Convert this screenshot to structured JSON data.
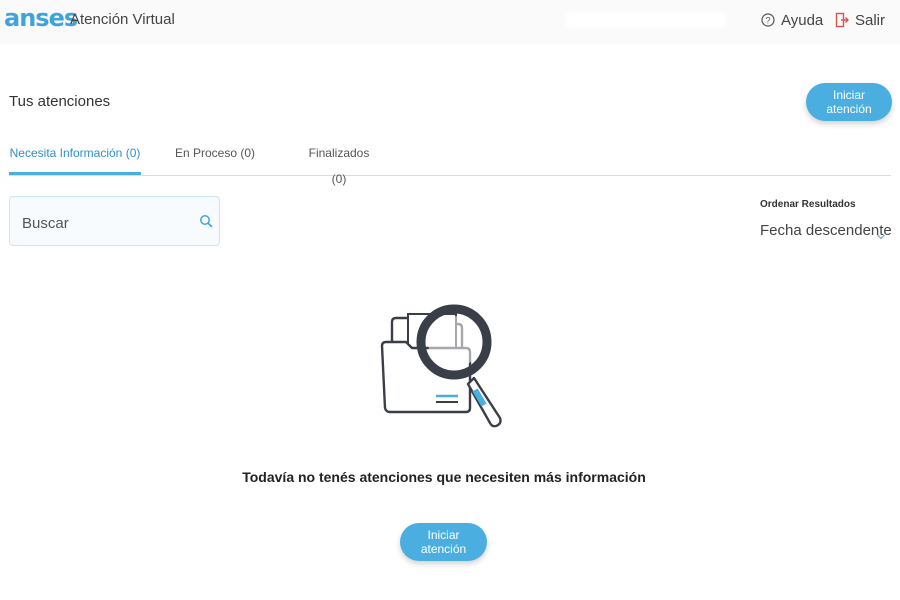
{
  "header": {
    "logo": "anses",
    "app_title": "Atención Virtual",
    "help_label": "Ayuda",
    "logout_label": "Salir"
  },
  "main": {
    "title": "Tus atenciones",
    "start_button_label": "Iniciar atención",
    "tabs": [
      {
        "label": "Necesita Información (0)",
        "active": true
      },
      {
        "label": "En Proceso (0)",
        "active": false
      },
      {
        "label": "Finalizados (0)",
        "active": false
      }
    ],
    "search": {
      "placeholder": "Buscar",
      "value": ""
    },
    "sort": {
      "label": "Ordenar Resultados",
      "value": "Fecha descendente"
    },
    "empty_state": {
      "message": "Todavía no tenés atenciones que necesiten más información",
      "button_label": "Iniciar atención"
    }
  },
  "colors": {
    "brand": "#3fa4dc",
    "accent": "#4aaee1",
    "logout_icon": "#d9534f"
  },
  "icons": [
    "help-icon",
    "logout-icon",
    "search-icon",
    "chevron-down-icon",
    "folder-magnifier-illustration"
  ]
}
